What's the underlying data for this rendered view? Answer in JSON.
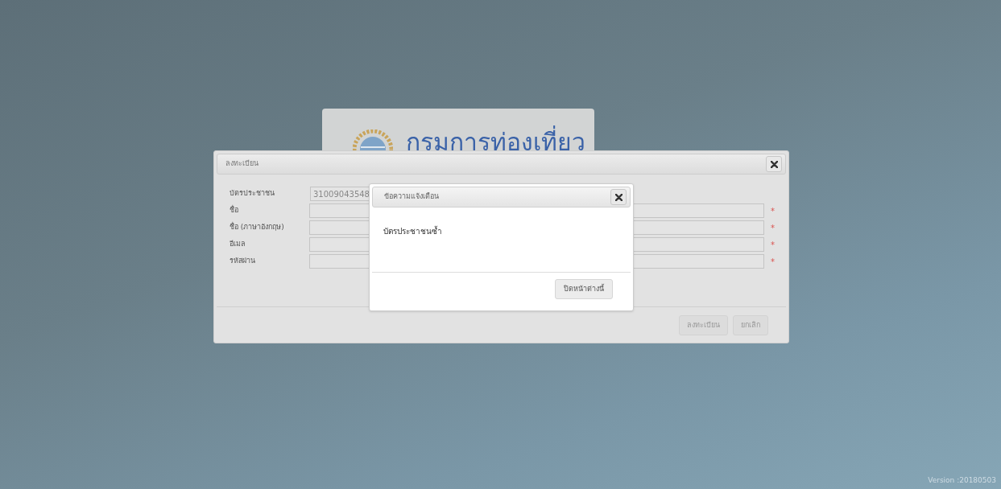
{
  "background_card": {
    "title": "กรมการท่องเที่ยว"
  },
  "register_dialog": {
    "title": "ลงทะเบียน",
    "fields": [
      {
        "label": "บัตรประชาชน",
        "value": "31009043548",
        "required": false
      },
      {
        "label": "ชื่อ",
        "required": true
      },
      {
        "label": "ชื่อ (ภาษาอังกฤษ)",
        "required": true
      },
      {
        "label": "อีเมล",
        "required": true
      },
      {
        "label": "รหัสผ่าน",
        "required": true
      }
    ],
    "required_mark": "*",
    "buttons": [
      "ลงทะเบียน",
      "ยกเลิก"
    ]
  },
  "alert_dialog": {
    "title": "ข้อความแจ้งเตือน",
    "message": "บัตรประชาชนซ้ำ",
    "button": "ปิดหน้าต่างนี้"
  },
  "version": "Version :20180503"
}
